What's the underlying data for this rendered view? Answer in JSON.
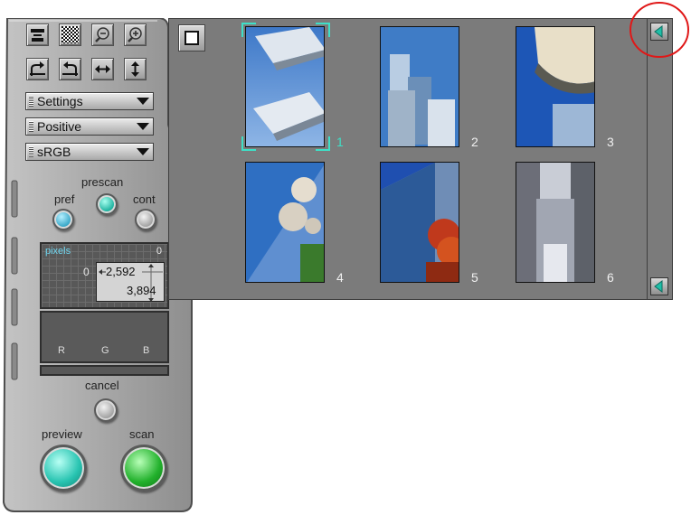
{
  "controls": {
    "settings_label": "Settings",
    "positive_label": "Positive",
    "srgb_label": "sRGB",
    "pref_label": "pref",
    "prescan_label": "prescan",
    "cont_label": "cont",
    "cancel_label": "cancel",
    "preview_label": "preview",
    "scan_label": "scan"
  },
  "info": {
    "units": "pixels",
    "corner_value": "0",
    "left_value": "0",
    "width": "2,592",
    "height": "3,894"
  },
  "histogram": {
    "channels": [
      "R",
      "G",
      "B"
    ]
  },
  "thumbnails": [
    {
      "number": "1",
      "selected": true
    },
    {
      "number": "2",
      "selected": false
    },
    {
      "number": "3",
      "selected": false
    },
    {
      "number": "4",
      "selected": false
    },
    {
      "number": "5",
      "selected": false
    },
    {
      "number": "6",
      "selected": false
    }
  ],
  "colors": {
    "accent_teal": "#3ee0c8",
    "annotation_red": "#e01818"
  }
}
